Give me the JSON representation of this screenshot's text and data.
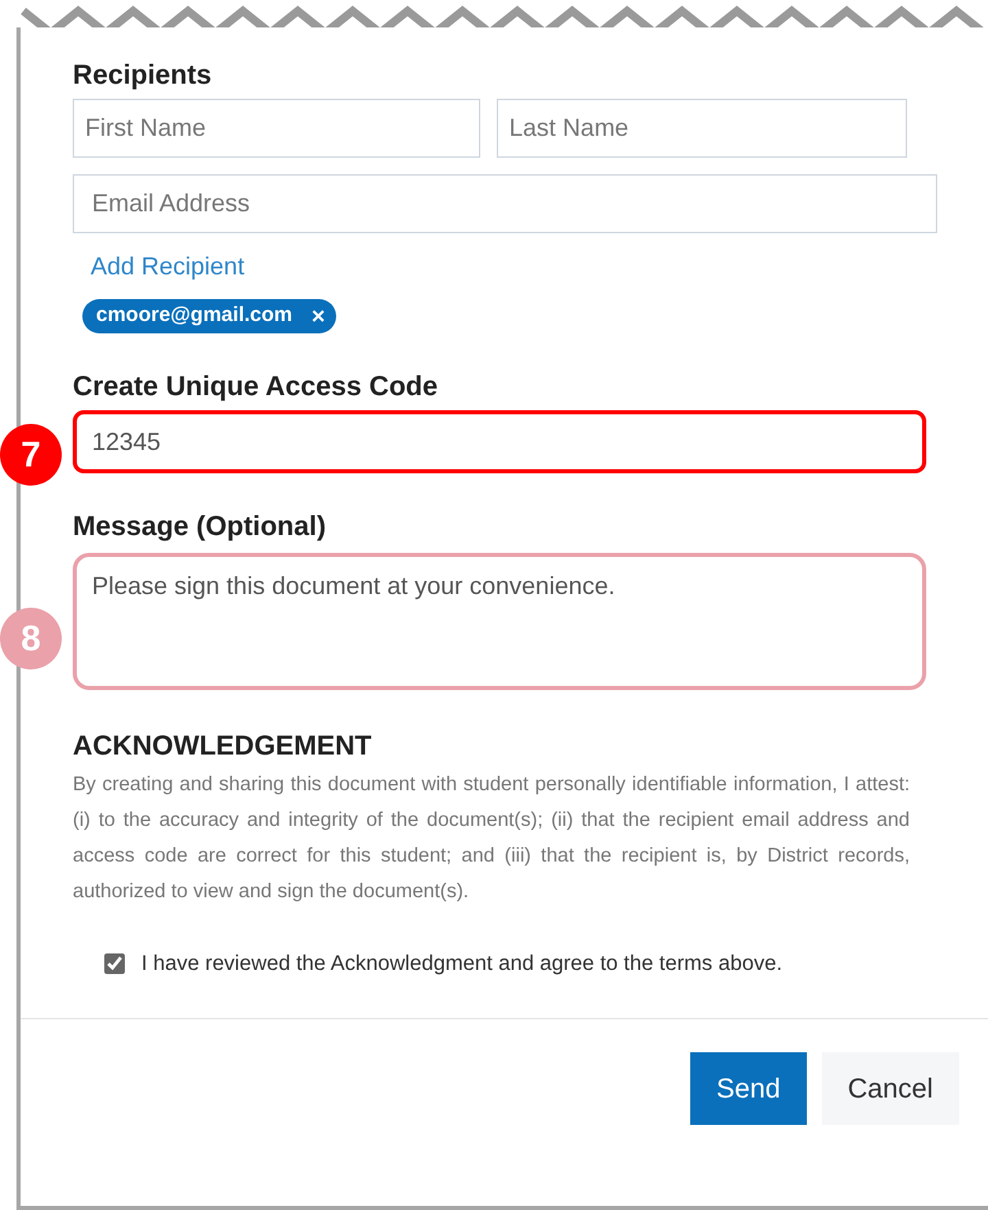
{
  "recipients": {
    "heading": "Recipients",
    "first_name": {
      "placeholder": "First Name"
    },
    "last_name": {
      "placeholder": "Last Name"
    },
    "email": {
      "placeholder": "Email Address"
    },
    "add_link": "Add Recipient",
    "chips": [
      {
        "label": "cmoore@gmail.com",
        "remove": "×"
      }
    ]
  },
  "access_code": {
    "label": "Create Unique Access Code",
    "value": "12345",
    "callout": {
      "number": "7",
      "color": "#ff0000"
    }
  },
  "message": {
    "label": "Message (Optional)",
    "value": "Please sign this document at your convenience.",
    "callout": {
      "number": "8",
      "color": "#eaa1aa"
    }
  },
  "acknowledgement": {
    "heading": "ACKNOWLEDGEMENT",
    "text": "By creating and sharing this document with student personally identifiable information, I attest: (i) to the accuracy and integrity of the document(s); (ii) that the recipient email address and access code are correct for this student; and (iii) that the recipient is, by District records, authorized to view and sign the document(s).",
    "checkbox": {
      "label": "I have reviewed the Acknowledgment and agree to the terms above.",
      "checked": true
    }
  },
  "buttons": [
    {
      "label": "Send",
      "kind": "primary"
    },
    {
      "label": "Cancel",
      "kind": "secondary"
    }
  ]
}
